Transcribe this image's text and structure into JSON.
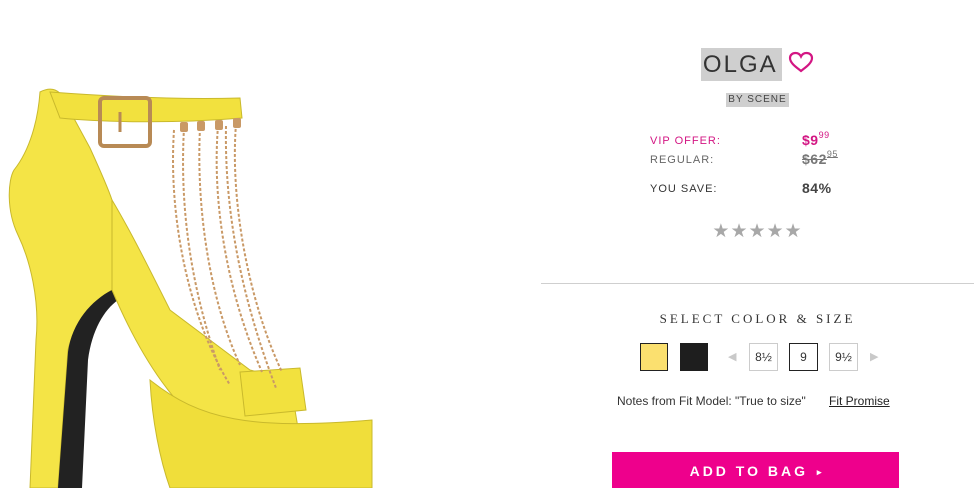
{
  "product": {
    "name": "OLGA",
    "brand": "BY SCENE",
    "image_alt": "Yellow platform heel sandal with gold chains"
  },
  "pricing": {
    "vip_label": "VIP OFFER:",
    "vip_dollars": "$9",
    "vip_cents": "99",
    "regular_label": "REGULAR:",
    "regular_dollars": "$62",
    "regular_cents": "95",
    "save_label": "YOU SAVE:",
    "save_value": "84%"
  },
  "rating": {
    "stars": "★★★★★",
    "value": 0,
    "max": 5
  },
  "selection": {
    "heading": "SELECT COLOR & SIZE",
    "colors": [
      {
        "name": "yellow",
        "hex": "#fbe06f",
        "selected": true
      },
      {
        "name": "black",
        "hex": "#1e1e1e",
        "selected": false
      }
    ],
    "prev_arrow": "◀",
    "next_arrow": "▶",
    "sizes": [
      "8½",
      "9",
      "9½"
    ],
    "selected_size": "9"
  },
  "fit": {
    "notes": "Notes from Fit Model: \"True to size\"",
    "promise_link": "Fit Promise"
  },
  "cart": {
    "add_label": "ADD TO BAG",
    "add_icon": "▸"
  },
  "colors": {
    "accent_pink": "#ee008c",
    "vip_pink": "#d31683",
    "star_gray": "#a8a8a8"
  }
}
